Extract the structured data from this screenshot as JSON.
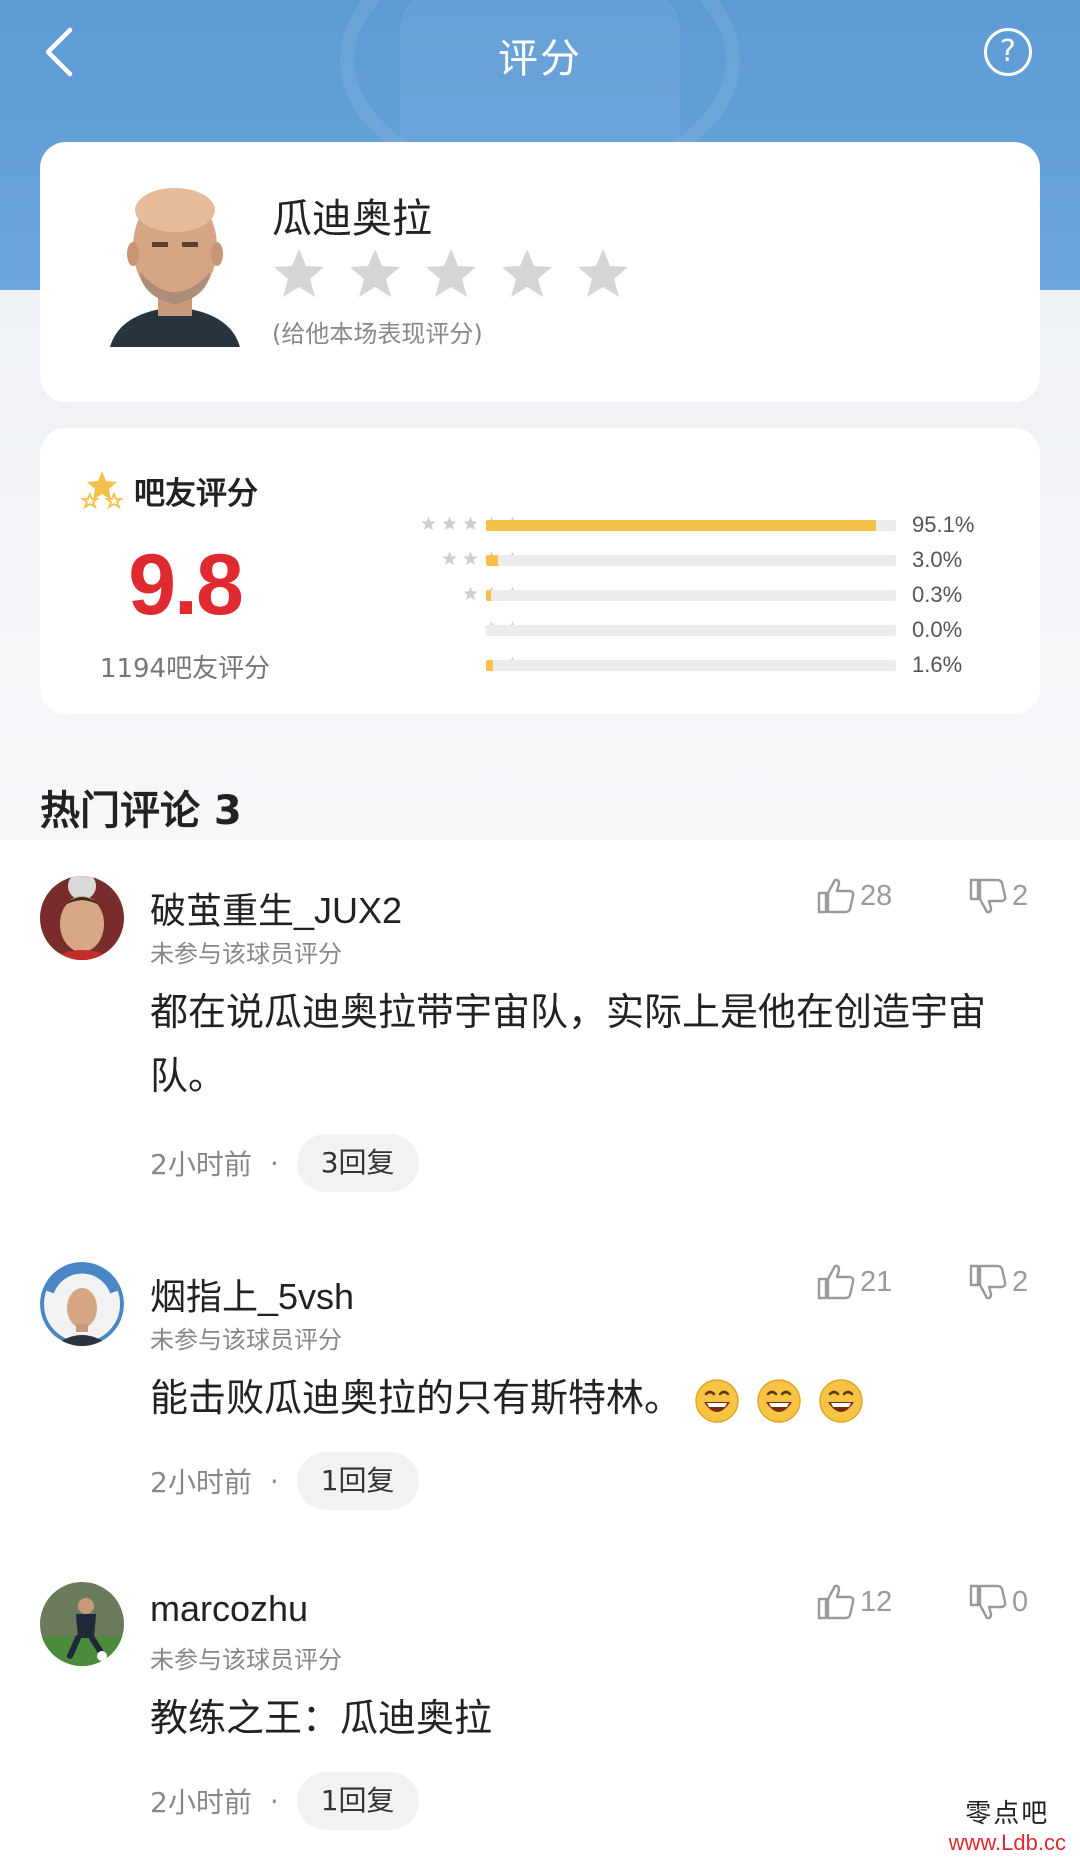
{
  "header": {
    "title": "评分",
    "help_glyph": "?"
  },
  "player": {
    "name": "瓜迪奥拉",
    "rating_hint": "(给他本场表现评分)",
    "stars_selected": 0,
    "stars_total": 5
  },
  "fan_rating": {
    "title": "吧友评分",
    "score": "9.8",
    "count_label": "1194吧友评分",
    "distribution": [
      {
        "stars": 5,
        "percent": 95.1,
        "label": "95.1%"
      },
      {
        "stars": 4,
        "percent": 3.0,
        "label": "3.0%"
      },
      {
        "stars": 3,
        "percent": 0.3,
        "label": "0.3%"
      },
      {
        "stars": 2,
        "percent": 0.0,
        "label": "0.0%"
      },
      {
        "stars": 1,
        "percent": 1.6,
        "label": "1.6%"
      }
    ]
  },
  "comments_section": {
    "title": "热门评论 3"
  },
  "comments": [
    {
      "user": "破茧重生_JUX2",
      "sub": "未参与该球员评分",
      "likes": "28",
      "dislikes": "2",
      "text": "都在说瓜迪奥拉带宇宙队，实际上是他在创造宇宙队。",
      "time": "2小时前",
      "replies": "3回复"
    },
    {
      "user": "烟指上_5vsh",
      "sub": "未参与该球员评分",
      "likes": "21",
      "dislikes": "2",
      "text": "能击败瓜迪奥拉的只有斯特林。",
      "time": "2小时前",
      "replies": "1回复"
    },
    {
      "user": "marcozhu",
      "sub": "未参与该球员评分",
      "likes": "12",
      "dislikes": "0",
      "text": "教练之王：瓜迪奥拉",
      "time": "2小时前",
      "replies": "1回复"
    }
  ],
  "watermark": {
    "cn": "零点吧",
    "url": "www.Ldb.cc"
  },
  "colors": {
    "header": "#6aa5dc",
    "score": "#e02a31",
    "bar": "#f5c04a",
    "star_inactive": "#d5d5d5"
  },
  "icons": [
    "back-arrow-icon",
    "help-icon",
    "star-icon",
    "thumbs-up-icon",
    "thumbs-down-icon",
    "laughing-emoji-icon"
  ]
}
